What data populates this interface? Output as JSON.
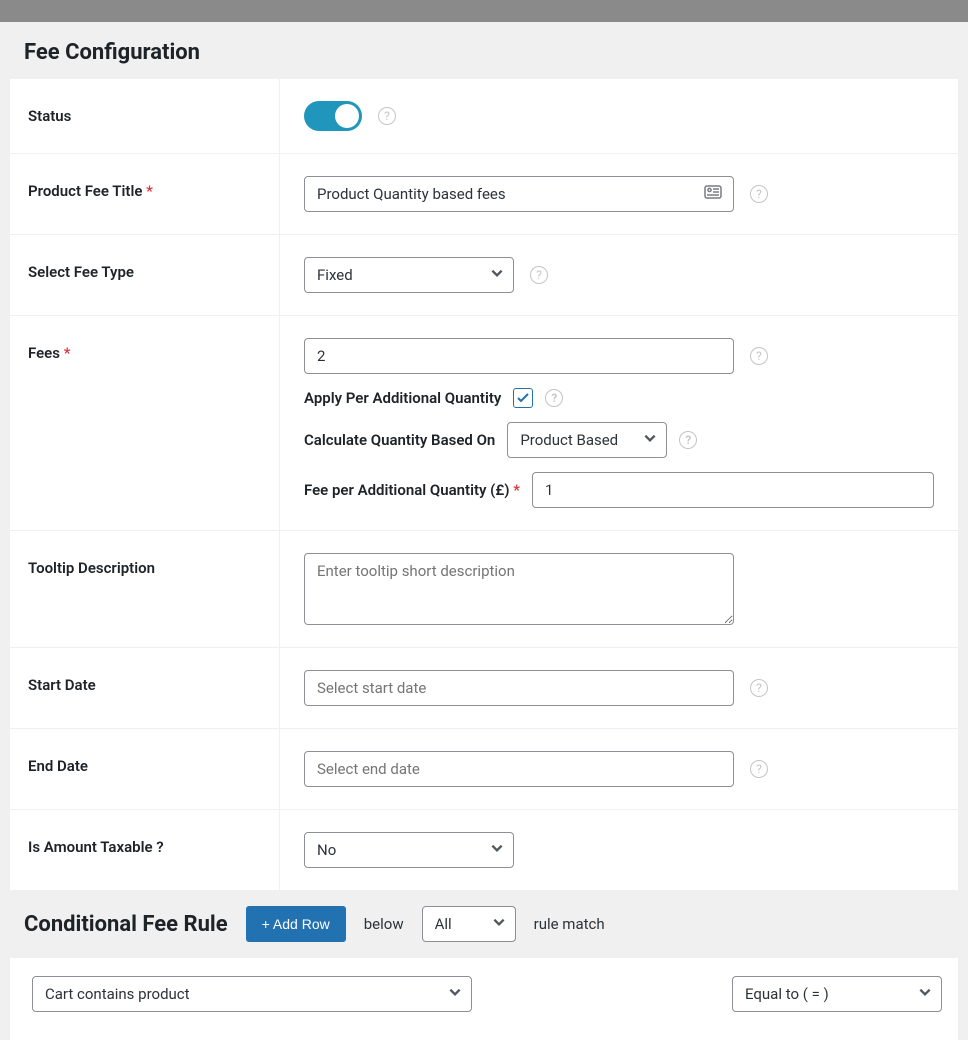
{
  "section1": {
    "title": "Fee Configuration",
    "status_label": "Status",
    "title_label": "Product Fee Title",
    "title_value": "Product Quantity based fees",
    "feetype_label": "Select Fee Type",
    "feetype_value": "Fixed",
    "fees_label": "Fees",
    "fees_value": "2",
    "apply_per_label": "Apply Per Additional Quantity",
    "calc_label": "Calculate Quantity Based On",
    "calc_value": "Product Based",
    "feeper_label": "Fee per Additional Quantity (£)",
    "feeper_value": "1",
    "tooltip_label": "Tooltip Description",
    "tooltip_placeholder": "Enter tooltip short description",
    "start_label": "Start Date",
    "start_placeholder": "Select start date",
    "end_label": "End Date",
    "end_placeholder": "Select end date",
    "tax_label": "Is Amount Taxable ?",
    "tax_value": "No"
  },
  "section2": {
    "title": "Conditional Fee Rule",
    "add_label": "+ Add Row",
    "below_text": "below",
    "match_select": "All",
    "match_text": "rule match",
    "rule_field": "Cart contains product",
    "rule_op": "Equal to ( = )"
  }
}
